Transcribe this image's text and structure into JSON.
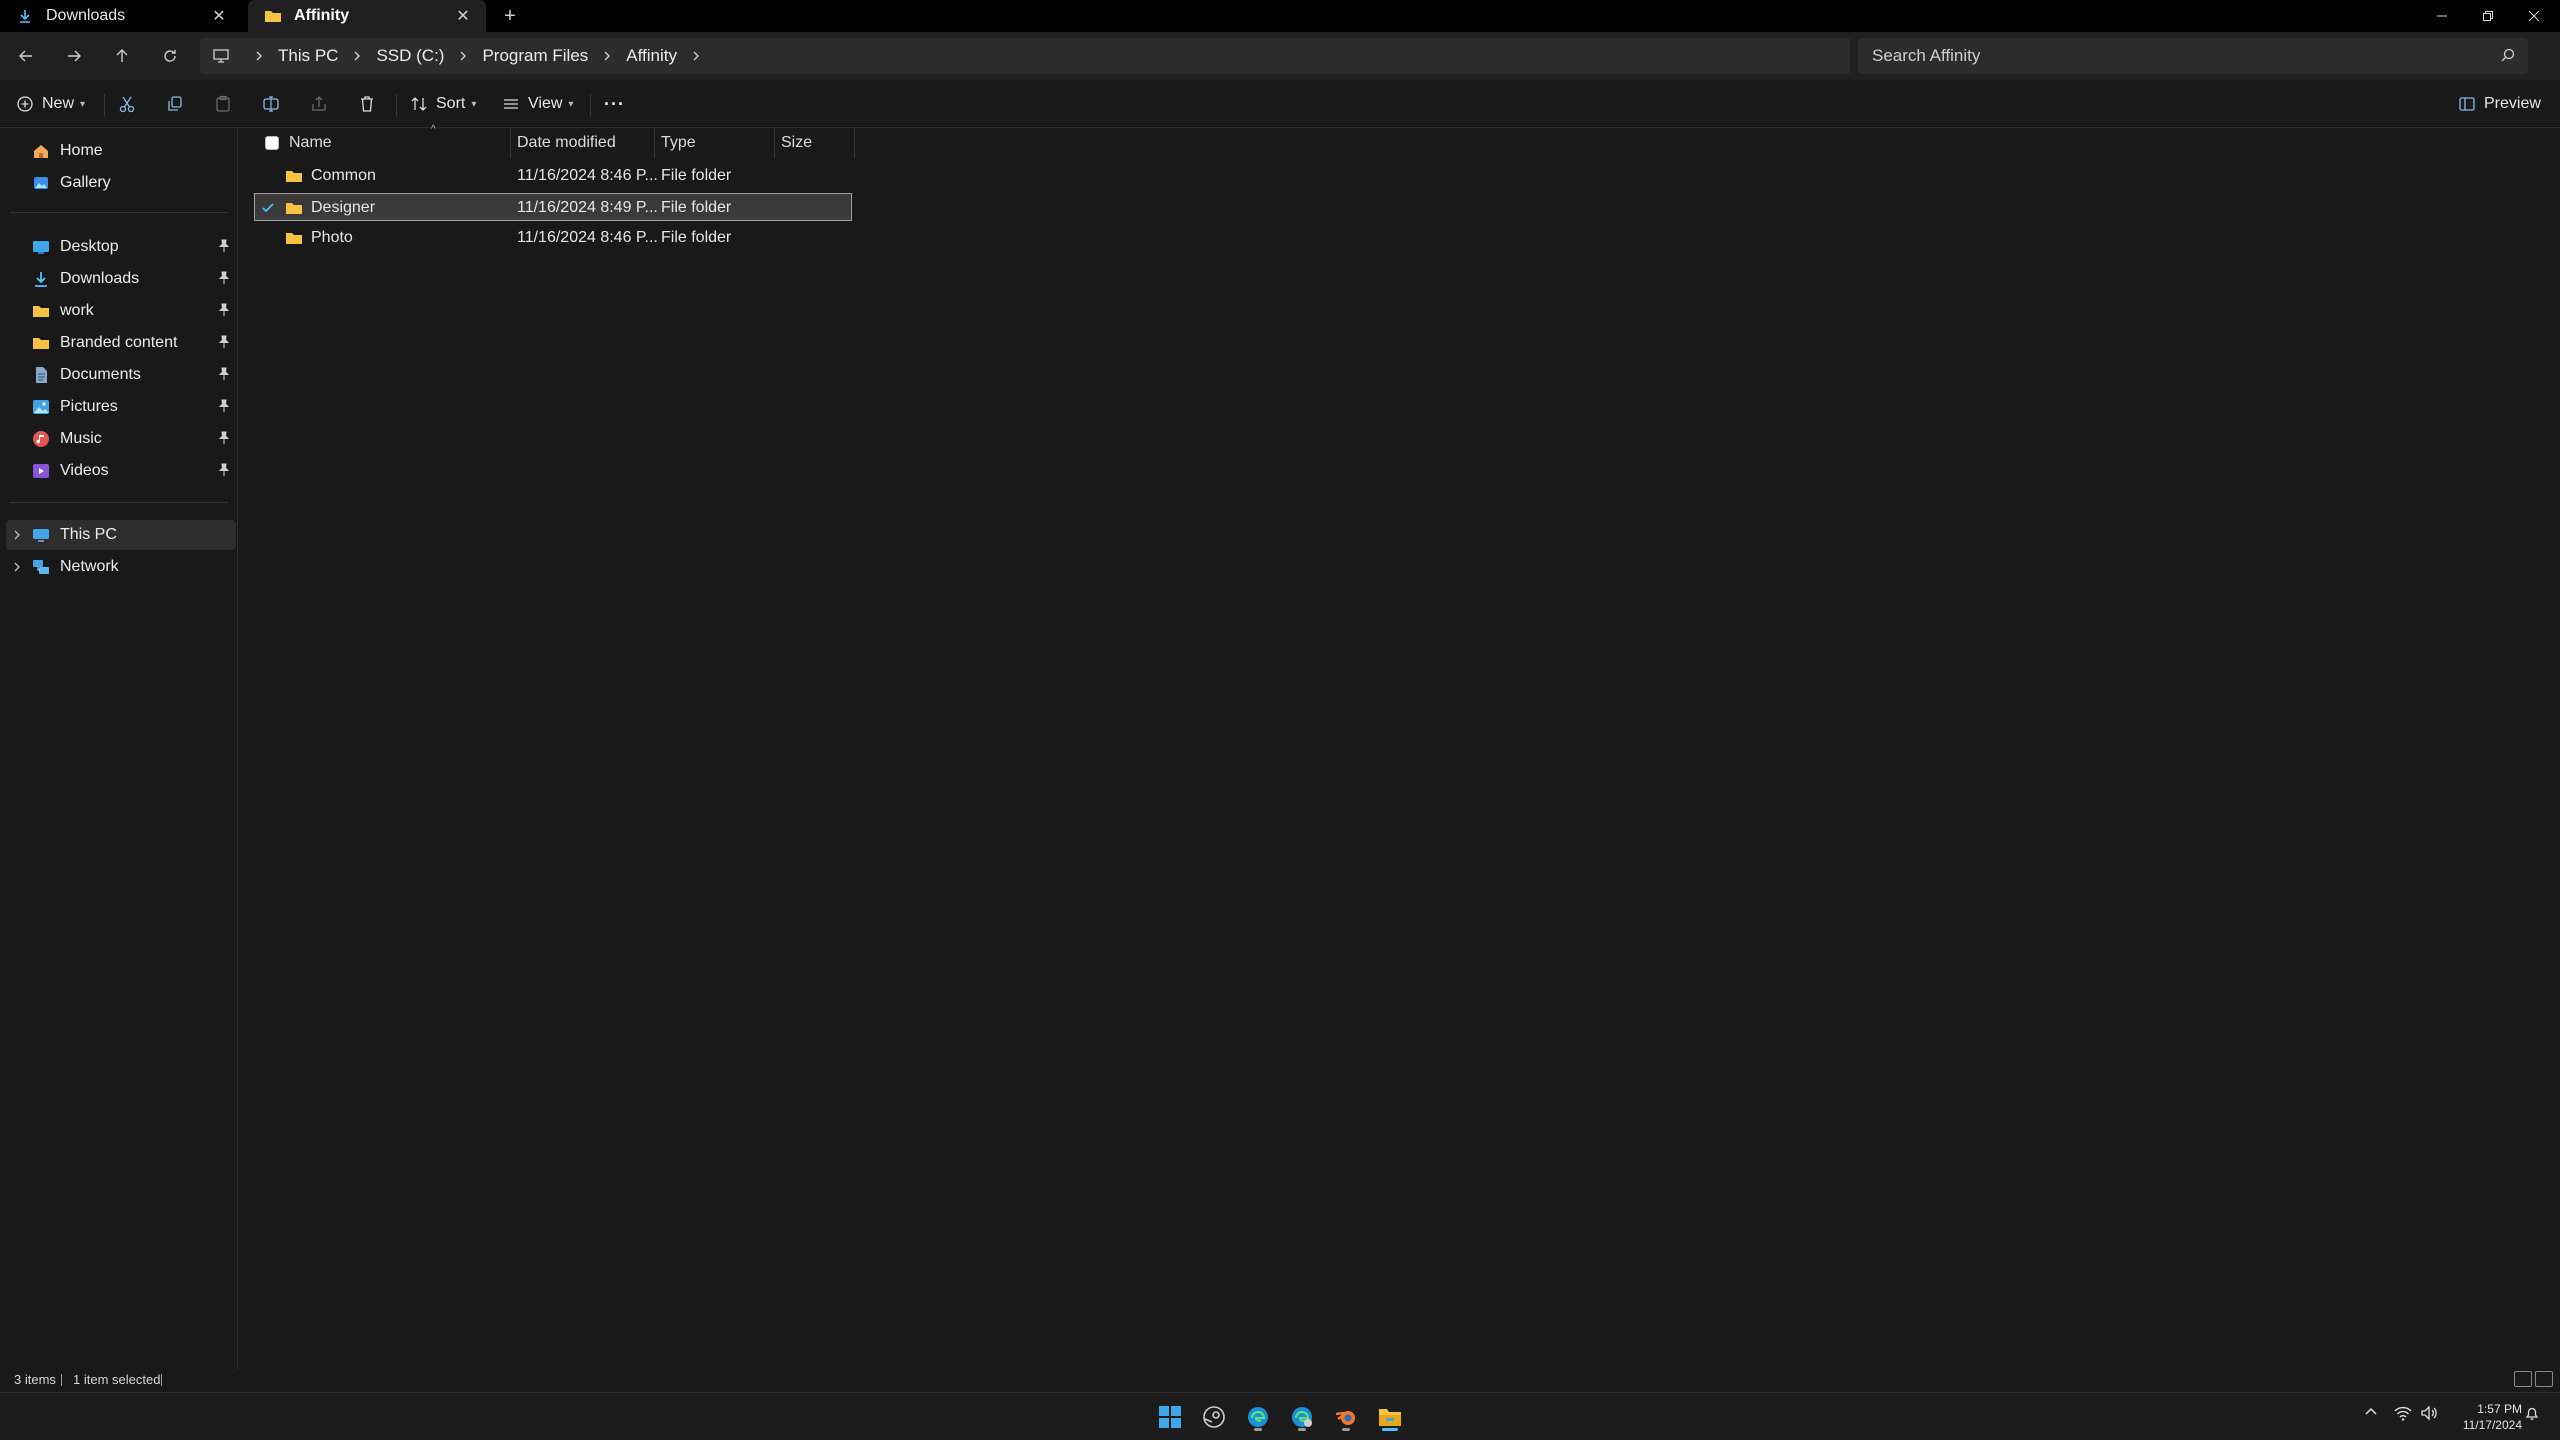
{
  "tabs": [
    {
      "label": "Downloads",
      "active": false
    },
    {
      "label": "Affinity",
      "active": true
    }
  ],
  "breadcrumb": [
    "This PC",
    "SSD (C:)",
    "Program Files",
    "Affinity"
  ],
  "search": {
    "placeholder": "Search Affinity"
  },
  "toolbar": {
    "new_label": "New",
    "sort_label": "Sort",
    "view_label": "View",
    "more_label": "···",
    "preview_label": "Preview"
  },
  "sidebar": {
    "top": [
      {
        "label": "Home",
        "icon": "home-icon"
      },
      {
        "label": "Gallery",
        "icon": "gallery-icon"
      }
    ],
    "pinned": [
      {
        "label": "Desktop",
        "icon": "desktop-icon"
      },
      {
        "label": "Downloads",
        "icon": "download-icon"
      },
      {
        "label": "work",
        "icon": "folder-icon"
      },
      {
        "label": "Branded content",
        "icon": "folder-icon"
      },
      {
        "label": "Documents",
        "icon": "documents-icon"
      },
      {
        "label": "Pictures",
        "icon": "pictures-icon"
      },
      {
        "label": "Music",
        "icon": "music-icon"
      },
      {
        "label": "Videos",
        "icon": "videos-icon"
      }
    ],
    "locations": [
      {
        "label": "This PC",
        "icon": "pc-icon",
        "selected": true
      },
      {
        "label": "Network",
        "icon": "network-icon",
        "selected": false
      }
    ]
  },
  "table": {
    "columns": [
      "Name",
      "Date modified",
      "Type",
      "Size"
    ],
    "rows": [
      {
        "name": "Common",
        "date": "11/16/2024 8:46 P...",
        "type": "File folder",
        "size": "",
        "selected": false
      },
      {
        "name": "Designer",
        "date": "11/16/2024 8:49 P...",
        "type": "File folder",
        "size": "",
        "selected": true
      },
      {
        "name": "Photo",
        "date": "11/16/2024 8:46 P...",
        "type": "File folder",
        "size": "",
        "selected": false
      }
    ]
  },
  "status": {
    "items": "3 items",
    "selected": "1 item selected"
  },
  "clock": {
    "time": "1:57 PM",
    "date": "11/17/2024"
  },
  "colors": {
    "folder": "#F5C242",
    "accent": "#4CC2FF",
    "background": "#191919"
  }
}
